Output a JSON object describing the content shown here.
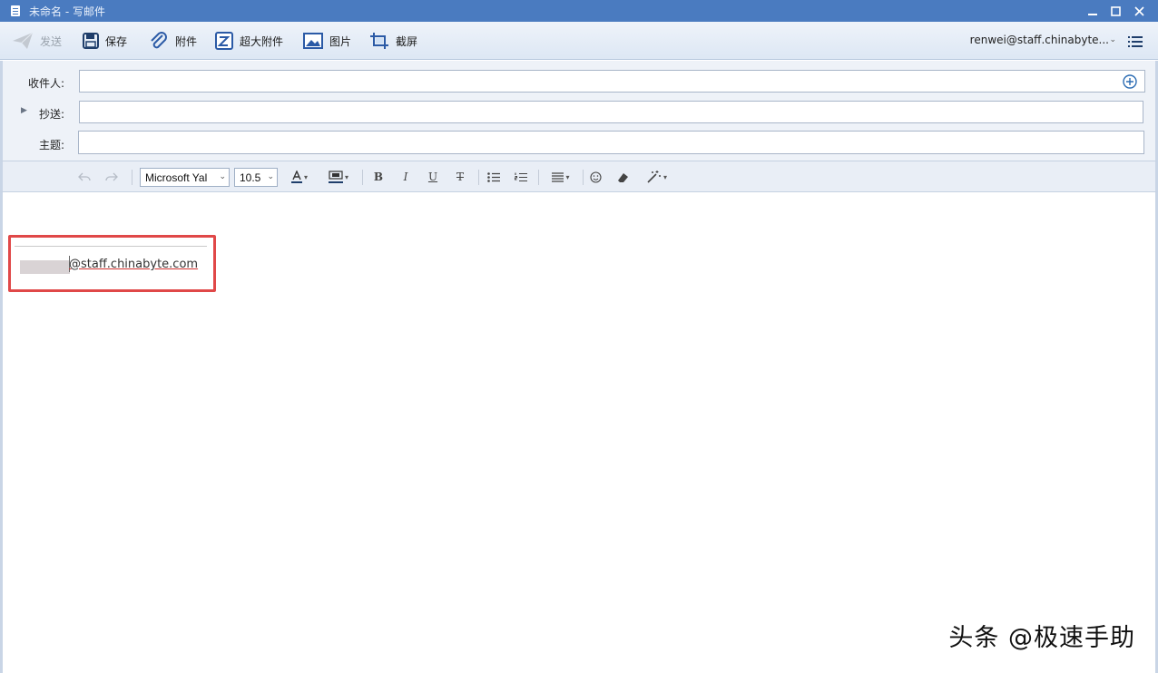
{
  "window": {
    "title": "未命名 - 写邮件",
    "controls": [
      "minimize",
      "maximize",
      "close"
    ]
  },
  "toolbar": {
    "send_label": "发送",
    "save_label": "保存",
    "attach_label": "附件",
    "big_attach_label": "超大附件",
    "image_label": "图片",
    "screenshot_label": "截屏",
    "account": "renwei@staff.chinabyte..."
  },
  "headers": {
    "to_label": "收件人:",
    "cc_label": "抄送:",
    "subject_label": "主题:",
    "to_value": "",
    "cc_value": "",
    "subject_value": ""
  },
  "format": {
    "font_family": "Microsoft Yal",
    "font_size": "10.5",
    "bold": "B",
    "italic": "I",
    "underline": "U",
    "strike": "T"
  },
  "body": {
    "signature_email": "@staff.chinabyte.com"
  },
  "watermark": "头条 @极速手助",
  "colors": {
    "titlebar": "#4a7bc0",
    "highlight": "#e04848"
  }
}
